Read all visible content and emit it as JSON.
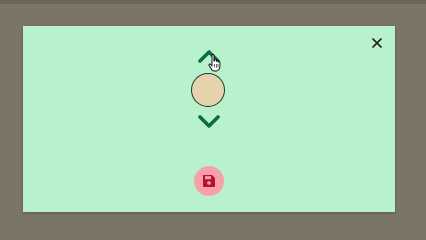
{
  "colors": {
    "backdrop": "#7b7566",
    "modal_background": "#b8f2cc",
    "chevron": "#0f6b45",
    "avatar_fill": "#e6d3ad",
    "save_button_bg": "#f7a0ab",
    "save_icon": "#b3132d",
    "close_icon": "#222222"
  },
  "icons": {
    "close": "close-icon",
    "up": "chevron-up-icon",
    "down": "chevron-down-icon",
    "save": "floppy-disk-icon",
    "cursor": "hand-pointer-cursor"
  }
}
